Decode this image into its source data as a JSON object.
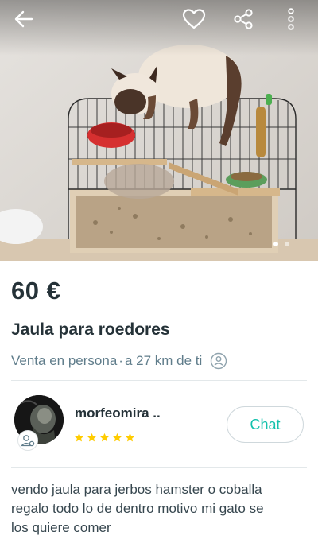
{
  "colors": {
    "accent": "#13c1ac",
    "text_primary": "#253238",
    "text_secondary": "#607d8b",
    "star": "#ffcc00"
  },
  "header": {
    "back_icon": "arrow-left-icon",
    "favorite_icon": "heart-outline-icon",
    "share_icon": "share-icon",
    "more_icon": "more-vertical-icon"
  },
  "gallery": {
    "total_images": 2,
    "current_index": 1
  },
  "product": {
    "price": "60 €",
    "title": "Jaula para roedores",
    "delivery_method": "Venta en persona",
    "separator": "·",
    "distance": "a 27 km de ti",
    "description": "vendo jaula para jerbos hamster o coballa\nregalo todo lo de dentro motivo mi gato se\nlos quiere comer"
  },
  "seller": {
    "name": "morfeomira ..",
    "rating": 5,
    "max_rating": 5,
    "badge_icon": "user-badge-icon"
  },
  "actions": {
    "chat_label": "Chat"
  }
}
